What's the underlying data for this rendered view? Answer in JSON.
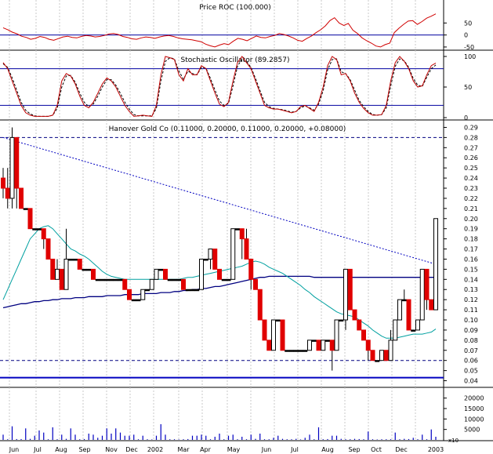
{
  "chart_data": [
    {
      "type": "line",
      "title": "Price ROC (100.000)",
      "ylim": [
        -60,
        100
      ],
      "y_ticks": [
        "50",
        "0",
        "-50"
      ],
      "series": [
        {
          "values": [
            30,
            22,
            12,
            5,
            -5,
            -10,
            -18,
            -14,
            -6,
            -10,
            -18,
            -22,
            -15,
            -8,
            -5,
            -10,
            -12,
            -6,
            -2,
            -4,
            -8,
            -6,
            -2,
            4,
            6,
            2,
            -6,
            -10,
            -16,
            -18,
            -12,
            -8,
            -10,
            -14,
            -8,
            -4,
            -2,
            -6,
            -12,
            -16,
            -18,
            -20,
            -24,
            -28,
            -38,
            -45,
            -50,
            -42,
            -36,
            -40,
            -26,
            -14,
            -18,
            -24,
            -14,
            -4,
            -10,
            -12,
            -6,
            -2,
            6,
            2,
            -4,
            -12,
            -22,
            -26,
            -14,
            -4,
            10,
            22,
            38,
            60,
            72,
            50,
            40,
            48,
            20,
            6,
            -12,
            -24,
            -34,
            -46,
            -50,
            -40,
            -34,
            10,
            28,
            44,
            58,
            60,
            44,
            56,
            70,
            78,
            88
          ]
        }
      ]
    },
    {
      "type": "line",
      "title": "Stochastic Oscillator (89.2857)",
      "ylim": [
        0,
        100
      ],
      "y_ticks": [
        "100",
        "50",
        "0"
      ],
      "hlines": [
        80,
        20
      ],
      "series": [
        {
          "values": [
            90,
            80,
            60,
            40,
            20,
            8,
            4,
            2,
            2,
            2,
            2,
            4,
            20,
            60,
            72,
            68,
            55,
            35,
            20,
            16,
            25,
            40,
            55,
            65,
            60,
            50,
            35,
            20,
            10,
            2,
            3,
            4,
            3,
            2,
            20,
            70,
            100,
            98,
            95,
            70,
            60,
            80,
            70,
            70,
            85,
            80,
            60,
            40,
            22,
            18,
            25,
            60,
            90,
            100,
            90,
            80,
            60,
            40,
            20,
            16,
            14,
            14,
            12,
            10,
            8,
            10,
            18,
            20,
            15,
            10,
            25,
            50,
            85,
            100,
            95,
            70,
            72,
            60,
            40,
            25,
            15,
            8,
            4,
            4,
            5,
            20,
            60,
            90,
            100,
            92,
            80,
            60,
            50,
            52,
            70,
            85,
            89.2857
          ]
        },
        {
          "values": [
            88,
            82,
            65,
            45,
            25,
            12,
            6,
            3,
            2,
            2,
            2,
            4,
            15,
            50,
            68,
            69,
            58,
            40,
            25,
            18,
            22,
            35,
            50,
            62,
            62,
            53,
            40,
            25,
            14,
            5,
            3,
            3,
            3,
            3,
            15,
            60,
            92,
            98,
            96,
            76,
            63,
            76,
            72,
            70,
            82,
            81,
            64,
            45,
            27,
            20,
            23,
            52,
            84,
            96,
            92,
            82,
            64,
            44,
            25,
            18,
            15,
            14,
            13,
            11,
            9,
            10,
            16,
            19,
            16,
            12,
            22,
            44,
            78,
            95,
            96,
            75,
            72,
            62,
            45,
            28,
            18,
            10,
            5,
            4,
            5,
            16,
            52,
            84,
            96,
            93,
            82,
            64,
            53,
            51,
            66,
            80,
            86
          ]
        }
      ]
    },
    {
      "type": "candlestick",
      "title": "Hanover Gold Co (0.11000, 0.20000, 0.11000, 0.20000, +0.08000)",
      "ylim": [
        0.035,
        0.295
      ],
      "y_ticks": [
        "0.29",
        "0.28",
        "0.27",
        "0.26",
        "0.25",
        "0.24",
        "0.23",
        "0.22",
        "0.21",
        "0.20",
        "0.19",
        "0.18",
        "0.17",
        "0.16",
        "0.15",
        "0.14",
        "0.13",
        "0.12",
        "0.11",
        "0.10",
        "0.09",
        "0.08",
        "0.07",
        "0.06",
        "0.05",
        "0.04"
      ],
      "x_labels": [
        "Jun",
        "Jul",
        "Aug",
        "Sep",
        "Nov",
        "Dec",
        "2002",
        "Mar",
        "Apr",
        "May",
        "Jun",
        "Jul",
        "Aug",
        "Sep",
        "Oct",
        "Dec",
        "2003"
      ],
      "hlines": [
        0.28,
        0.06
      ],
      "trendline": [
        [
          0,
          0.28
        ],
        [
          96,
          0.155
        ]
      ],
      "bars": [
        [
          0.24,
          0.23,
          0.25,
          0.22
        ],
        [
          0.23,
          0.22,
          0.25,
          0.21
        ],
        [
          0.22,
          0.28,
          0.29,
          0.21
        ],
        [
          0.28,
          0.23,
          0.28,
          0.21
        ],
        [
          0.23,
          0.21,
          0.23,
          0.21
        ],
        [
          0.21,
          0.21,
          0.21,
          0.21
        ],
        [
          0.21,
          0.19,
          0.21,
          0.19
        ],
        [
          0.19,
          0.19,
          0.19,
          0.19
        ],
        [
          0.19,
          0.19,
          0.19,
          0.19
        ],
        [
          0.19,
          0.18,
          0.19,
          0.17
        ],
        [
          0.18,
          0.16,
          0.18,
          0.16
        ],
        [
          0.16,
          0.14,
          0.16,
          0.14
        ],
        [
          0.14,
          0.15,
          0.16,
          0.14
        ],
        [
          0.15,
          0.13,
          0.15,
          0.13
        ],
        [
          0.13,
          0.16,
          0.19,
          0.13
        ],
        [
          0.16,
          0.16,
          0.16,
          0.16
        ],
        [
          0.16,
          0.16,
          0.16,
          0.16
        ],
        [
          0.16,
          0.15,
          0.16,
          0.15
        ],
        [
          0.15,
          0.15,
          0.15,
          0.15
        ],
        [
          0.15,
          0.15,
          0.15,
          0.15
        ],
        [
          0.15,
          0.14,
          0.15,
          0.14
        ],
        [
          0.14,
          0.14,
          0.14,
          0.14
        ],
        [
          0.14,
          0.14,
          0.14,
          0.14
        ],
        [
          0.14,
          0.14,
          0.14,
          0.14
        ],
        [
          0.14,
          0.14,
          0.14,
          0.14
        ],
        [
          0.14,
          0.14,
          0.14,
          0.14
        ],
        [
          0.14,
          0.14,
          0.14,
          0.14
        ],
        [
          0.14,
          0.13,
          0.14,
          0.13
        ],
        [
          0.13,
          0.12,
          0.13,
          0.12
        ],
        [
          0.12,
          0.12,
          0.12,
          0.12
        ],
        [
          0.12,
          0.12,
          0.12,
          0.12
        ],
        [
          0.12,
          0.13,
          0.13,
          0.12
        ],
        [
          0.13,
          0.13,
          0.13,
          0.13
        ],
        [
          0.13,
          0.14,
          0.14,
          0.13
        ],
        [
          0.14,
          0.15,
          0.15,
          0.14
        ],
        [
          0.15,
          0.15,
          0.15,
          0.15
        ],
        [
          0.15,
          0.14,
          0.15,
          0.14
        ],
        [
          0.14,
          0.14,
          0.14,
          0.14
        ],
        [
          0.14,
          0.14,
          0.14,
          0.14
        ],
        [
          0.14,
          0.14,
          0.14,
          0.14
        ],
        [
          0.14,
          0.13,
          0.14,
          0.13
        ],
        [
          0.13,
          0.13,
          0.13,
          0.13
        ],
        [
          0.13,
          0.13,
          0.13,
          0.13
        ],
        [
          0.13,
          0.13,
          0.13,
          0.13
        ],
        [
          0.13,
          0.16,
          0.16,
          0.13
        ],
        [
          0.16,
          0.16,
          0.16,
          0.16
        ],
        [
          0.16,
          0.17,
          0.17,
          0.15
        ],
        [
          0.17,
          0.15,
          0.17,
          0.15
        ],
        [
          0.15,
          0.14,
          0.15,
          0.14
        ],
        [
          0.14,
          0.14,
          0.14,
          0.14
        ],
        [
          0.14,
          0.14,
          0.14,
          0.14
        ],
        [
          0.14,
          0.19,
          0.19,
          0.14
        ],
        [
          0.19,
          0.19,
          0.19,
          0.19
        ],
        [
          0.19,
          0.18,
          0.19,
          0.16
        ],
        [
          0.18,
          0.16,
          0.19,
          0.16
        ],
        [
          0.16,
          0.14,
          0.16,
          0.13
        ],
        [
          0.14,
          0.13,
          0.14,
          0.13
        ],
        [
          0.13,
          0.1,
          0.13,
          0.1
        ],
        [
          0.1,
          0.08,
          0.1,
          0.08
        ],
        [
          0.08,
          0.07,
          0.08,
          0.07
        ],
        [
          0.07,
          0.1,
          0.1,
          0.07
        ],
        [
          0.1,
          0.1,
          0.1,
          0.1
        ],
        [
          0.1,
          0.07,
          0.1,
          0.07
        ],
        [
          0.07,
          0.07,
          0.07,
          0.07
        ],
        [
          0.07,
          0.07,
          0.07,
          0.07
        ],
        [
          0.07,
          0.07,
          0.07,
          0.07
        ],
        [
          0.07,
          0.07,
          0.07,
          0.07
        ],
        [
          0.07,
          0.07,
          0.07,
          0.07
        ],
        [
          0.07,
          0.08,
          0.08,
          0.07
        ],
        [
          0.08,
          0.08,
          0.08,
          0.08
        ],
        [
          0.08,
          0.07,
          0.08,
          0.07
        ],
        [
          0.07,
          0.08,
          0.08,
          0.07
        ],
        [
          0.08,
          0.08,
          0.08,
          0.08
        ],
        [
          0.08,
          0.07,
          0.08,
          0.05
        ],
        [
          0.07,
          0.1,
          0.1,
          0.07
        ],
        [
          0.1,
          0.1,
          0.1,
          0.1
        ],
        [
          0.1,
          0.15,
          0.15,
          0.09
        ],
        [
          0.15,
          0.11,
          0.15,
          0.11
        ],
        [
          0.11,
          0.1,
          0.11,
          0.1
        ],
        [
          0.1,
          0.09,
          0.1,
          0.09
        ],
        [
          0.09,
          0.08,
          0.09,
          0.08
        ],
        [
          0.08,
          0.07,
          0.08,
          0.06
        ],
        [
          0.07,
          0.06,
          0.07,
          0.06
        ],
        [
          0.06,
          0.06,
          0.06,
          0.06
        ],
        [
          0.06,
          0.07,
          0.07,
          0.06
        ],
        [
          0.07,
          0.06,
          0.07,
          0.06
        ],
        [
          0.06,
          0.08,
          0.09,
          0.06
        ],
        [
          0.08,
          0.1,
          0.1,
          0.08
        ],
        [
          0.1,
          0.12,
          0.12,
          0.1
        ],
        [
          0.12,
          0.12,
          0.13,
          0.12
        ],
        [
          0.12,
          0.09,
          0.12,
          0.09
        ],
        [
          0.09,
          0.09,
          0.09,
          0.09
        ],
        [
          0.09,
          0.1,
          0.1,
          0.09
        ],
        [
          0.1,
          0.15,
          0.15,
          0.1
        ],
        [
          0.15,
          0.12,
          0.15,
          0.11
        ],
        [
          0.12,
          0.11,
          0.12,
          0.11
        ],
        [
          0.11,
          0.2,
          0.2,
          0.11
        ]
      ],
      "ma_short": [
        0.12,
        0.13,
        0.14,
        0.15,
        0.16,
        0.17,
        0.18,
        0.185,
        0.19,
        0.192,
        0.193,
        0.19,
        0.185,
        0.18,
        0.175,
        0.17,
        0.168,
        0.165,
        0.163,
        0.16,
        0.156,
        0.152,
        0.148,
        0.145,
        0.143,
        0.142,
        0.141,
        0.14,
        0.14,
        0.14,
        0.14,
        0.14,
        0.14,
        0.14,
        0.14,
        0.14,
        0.14,
        0.14,
        0.14,
        0.14,
        0.141,
        0.142,
        0.142,
        0.143,
        0.144,
        0.145,
        0.146,
        0.147,
        0.148,
        0.149,
        0.15,
        0.151,
        0.152,
        0.153,
        0.155,
        0.157,
        0.158,
        0.157,
        0.155,
        0.152,
        0.15,
        0.148,
        0.146,
        0.143,
        0.14,
        0.137,
        0.134,
        0.13,
        0.127,
        0.123,
        0.12,
        0.117,
        0.114,
        0.111,
        0.108,
        0.106,
        0.105,
        0.104,
        0.103,
        0.1,
        0.097,
        0.094,
        0.09,
        0.087,
        0.084,
        0.082,
        0.082,
        0.082,
        0.083,
        0.084,
        0.085,
        0.086,
        0.086,
        0.086,
        0.087,
        0.088,
        0.091
      ],
      "ma_long": [
        0.112,
        0.113,
        0.114,
        0.115,
        0.116,
        0.116,
        0.117,
        0.118,
        0.118,
        0.119,
        0.119,
        0.12,
        0.12,
        0.121,
        0.121,
        0.121,
        0.122,
        0.122,
        0.122,
        0.123,
        0.123,
        0.123,
        0.123,
        0.124,
        0.124,
        0.124,
        0.124,
        0.125,
        0.125,
        0.125,
        0.125,
        0.126,
        0.126,
        0.126,
        0.126,
        0.127,
        0.127,
        0.127,
        0.128,
        0.128,
        0.129,
        0.129,
        0.13,
        0.13,
        0.131,
        0.131,
        0.132,
        0.133,
        0.133,
        0.134,
        0.135,
        0.136,
        0.137,
        0.138,
        0.139,
        0.14,
        0.141,
        0.142,
        0.142,
        0.143,
        0.143,
        0.143,
        0.143,
        0.143,
        0.143,
        0.143,
        0.143,
        0.143,
        0.143,
        0.142,
        0.142,
        0.142,
        0.142,
        0.142,
        0.142,
        0.142,
        0.142,
        0.142,
        0.142,
        0.142,
        0.142,
        0.142,
        0.142,
        0.142,
        0.142,
        0.142,
        0.142,
        0.142,
        0.142,
        0.142,
        0.142,
        0.142,
        0.142,
        0.142,
        0.142,
        0.142,
        0.142
      ]
    },
    {
      "type": "bar",
      "title": "",
      "ylim": [
        0,
        24000
      ],
      "y_ticks": [
        "20000",
        "15000",
        "10000",
        "5000"
      ],
      "unit_label": "x10",
      "values": [
        2500,
        300,
        6500,
        400,
        400,
        5500,
        500,
        2000,
        4500,
        3500,
        300,
        6000,
        300,
        2500,
        500,
        5500,
        2500,
        300,
        400,
        3000,
        2500,
        1000,
        2000,
        5500,
        3000,
        5500,
        3500,
        2000,
        2000,
        2500,
        300,
        2000,
        300,
        200,
        2000,
        7500,
        2500,
        300,
        300,
        200,
        300,
        400,
        2000,
        2000,
        2500,
        2000,
        300,
        1500,
        3000,
        300,
        2000,
        2500,
        300,
        1500,
        300,
        2500,
        500,
        3000,
        300,
        300,
        1000,
        2000,
        500,
        300,
        300,
        500,
        200,
        1000,
        2500,
        300,
        6000,
        300,
        400,
        2000,
        2000,
        500,
        300,
        300,
        500,
        400,
        300,
        4000,
        300,
        200,
        300,
        300,
        300,
        3500,
        300,
        500,
        400,
        1000,
        300,
        2500,
        300,
        5000,
        1500
      ]
    }
  ]
}
